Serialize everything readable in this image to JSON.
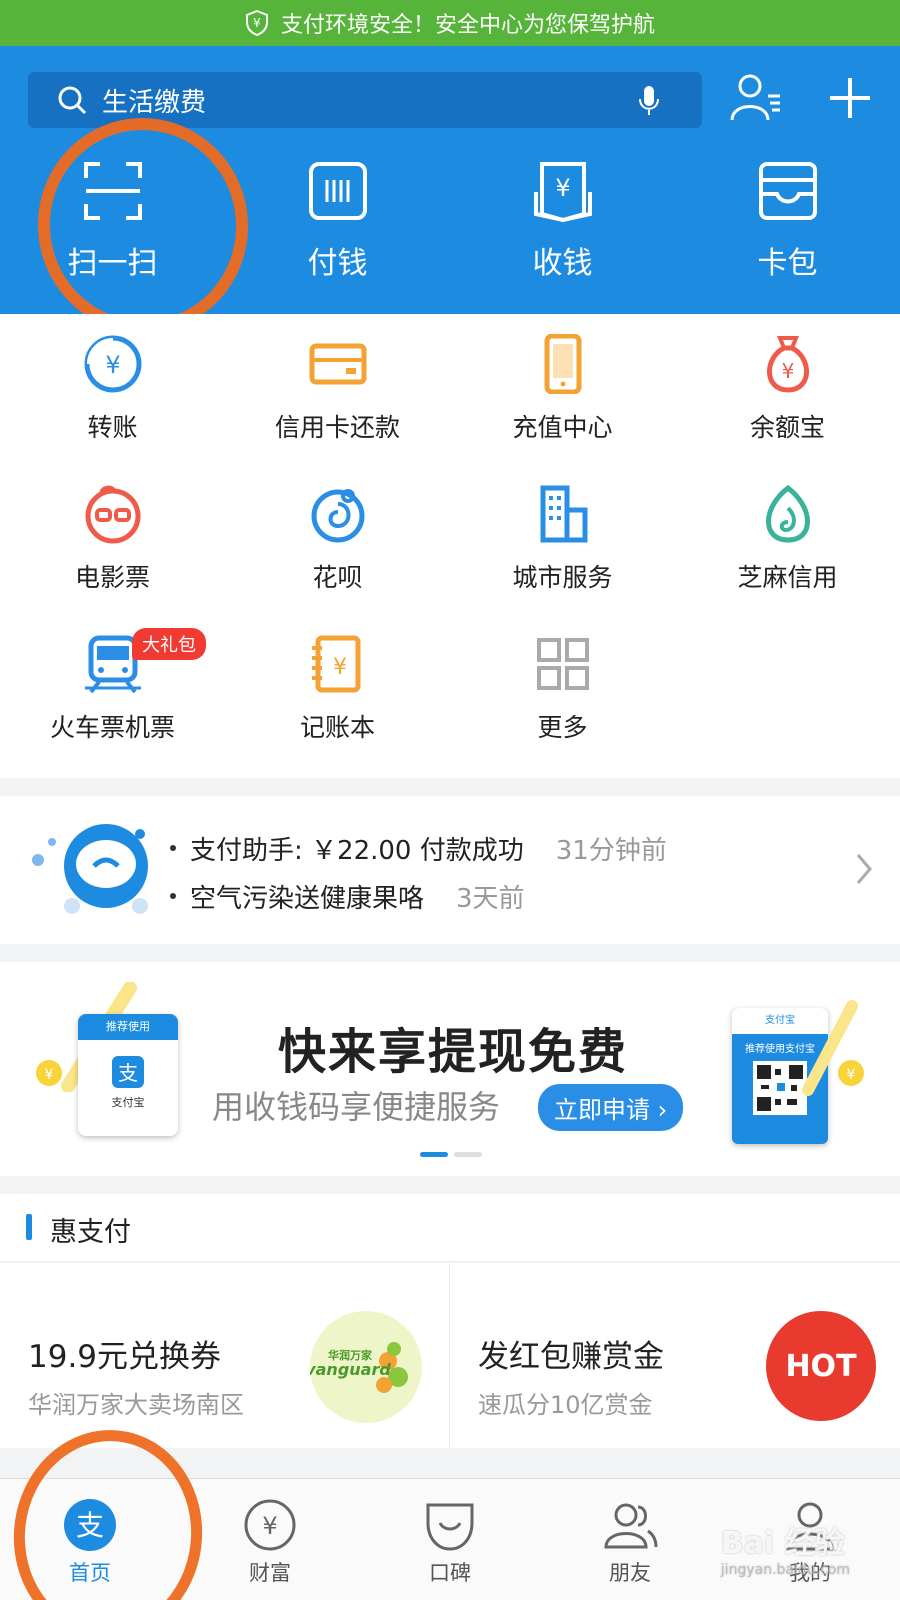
{
  "secure_bar": {
    "text": "支付环境安全！安全中心为您保驾护航",
    "color": "#56b43a"
  },
  "search": {
    "text": "生活缴费"
  },
  "top_actions": [
    {
      "icon": "scan-icon",
      "label": "扫一扫"
    },
    {
      "icon": "pay-code-icon",
      "label": "付钱"
    },
    {
      "icon": "receive-money-icon",
      "label": "收钱"
    },
    {
      "icon": "card-wallet-icon",
      "label": "卡包"
    }
  ],
  "grid": [
    {
      "icon": "transfer-icon",
      "label": "转账"
    },
    {
      "icon": "credit-card-icon",
      "label": "信用卡还款"
    },
    {
      "icon": "phone-topup-icon",
      "label": "充值中心"
    },
    {
      "icon": "money-bag-icon",
      "label": "余额宝"
    },
    {
      "icon": "movie-icon",
      "label": "电影票"
    },
    {
      "icon": "huabei-icon",
      "label": "花呗"
    },
    {
      "icon": "city-icon",
      "label": "城市服务"
    },
    {
      "icon": "sesame-icon",
      "label": "芝麻信用"
    },
    {
      "icon": "train-icon",
      "label": "火车票机票",
      "badge": "大礼包"
    },
    {
      "icon": "ledger-icon",
      "label": "记账本"
    },
    {
      "icon": "more-grid-icon",
      "label": "更多"
    }
  ],
  "notice": {
    "lines": [
      {
        "text": "支付助手: ￥22.00 付款成功",
        "time": "31分钟前"
      },
      {
        "text": "空气污染送健康果咯",
        "time": "3天前"
      }
    ]
  },
  "banner": {
    "title": "快来享提现免费",
    "subtitle": "用收钱码享便捷服务",
    "button": "立即申请",
    "left_card_cap": "推荐使用",
    "left_card_label": "支付宝",
    "right_card_top": "支付宝",
    "right_card_rec": "推荐使用支付宝"
  },
  "section": {
    "title": "惠支付"
  },
  "promos": [
    {
      "title": "19.9元兑换券",
      "subtitle": "华润万家大卖场南区",
      "logo_text": "华润万家 vanguard"
    },
    {
      "title": "发红包赚赏金",
      "subtitle": "速瓜分10亿赏金",
      "logo_text": "HOT"
    }
  ],
  "tabs": [
    {
      "icon": "alipay-home-icon",
      "label": "首页",
      "active": true
    },
    {
      "icon": "wealth-icon",
      "label": "财富"
    },
    {
      "icon": "koubei-icon",
      "label": "口碑"
    },
    {
      "icon": "friends-icon",
      "label": "朋友"
    },
    {
      "icon": "profile-icon",
      "label": "我的"
    }
  ],
  "watermark": {
    "text": "Bai 经验",
    "sub": "jingyan.baidu.com"
  },
  "colors": {
    "primary": "#1d8ce0",
    "annotation": "#ee6a1f"
  }
}
